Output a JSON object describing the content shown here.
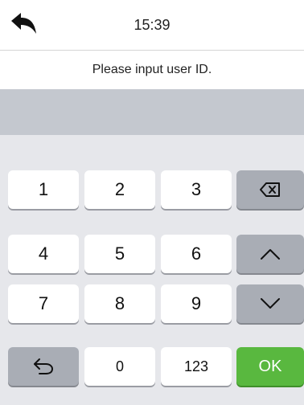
{
  "header": {
    "time": "15:39",
    "back_icon": "back-arrow-icon"
  },
  "prompt": {
    "text": "Please input user ID."
  },
  "input": {
    "value": ""
  },
  "keypad": {
    "keys": {
      "k1": "1",
      "k2": "2",
      "k3": "3",
      "k4": "4",
      "k5": "5",
      "k6": "6",
      "k7": "7",
      "k8": "8",
      "k9": "9",
      "k0": "0",
      "mode": "123",
      "ok": "OK"
    },
    "icons": {
      "backspace": "backspace-icon",
      "up": "chevron-up-icon",
      "down": "chevron-down-icon",
      "undo": "undo-icon"
    },
    "colors": {
      "ok": "#59b83f",
      "function_key": "#a9adb5",
      "input_bar": "#c4c8cf"
    }
  }
}
